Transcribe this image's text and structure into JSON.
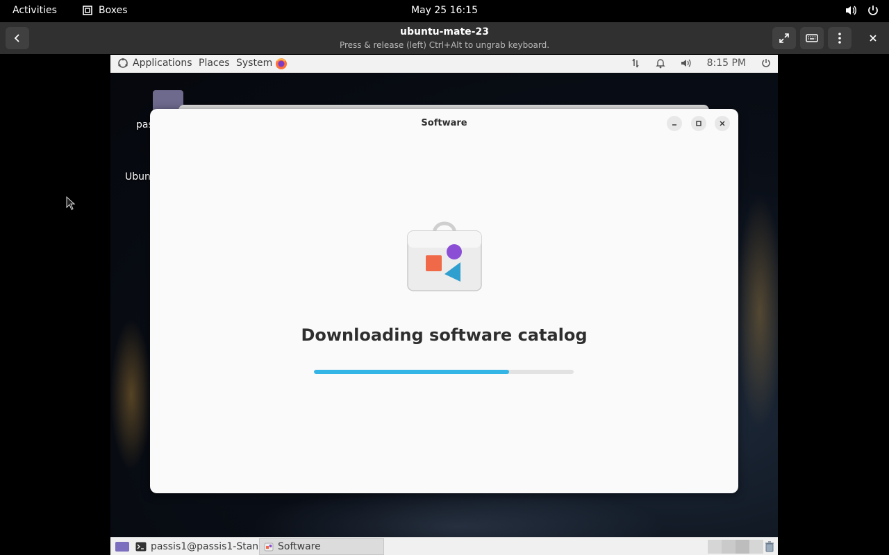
{
  "gnome": {
    "activities": "Activities",
    "app": "Boxes",
    "clock": "May 25  16:15"
  },
  "boxes": {
    "title": "ubuntu-mate-23",
    "subtitle": "Press & release (left) Ctrl+Alt to ungrab keyboard."
  },
  "mate_panel": {
    "applications": "Applications",
    "places": "Places",
    "system": "System",
    "time": "8:15 PM"
  },
  "desktop": {
    "icon1_label": "pas",
    "icon2_label": "Ubun"
  },
  "software": {
    "title": "Software",
    "status": "Downloading software catalog",
    "progress": 0.75
  },
  "taskbar": {
    "task1": "passis1@passis1-Stan...",
    "task2": "Software"
  },
  "colors": {
    "progress": "#33b5e5",
    "gnome_bar": "#000000",
    "boxes_header": "#303030"
  }
}
